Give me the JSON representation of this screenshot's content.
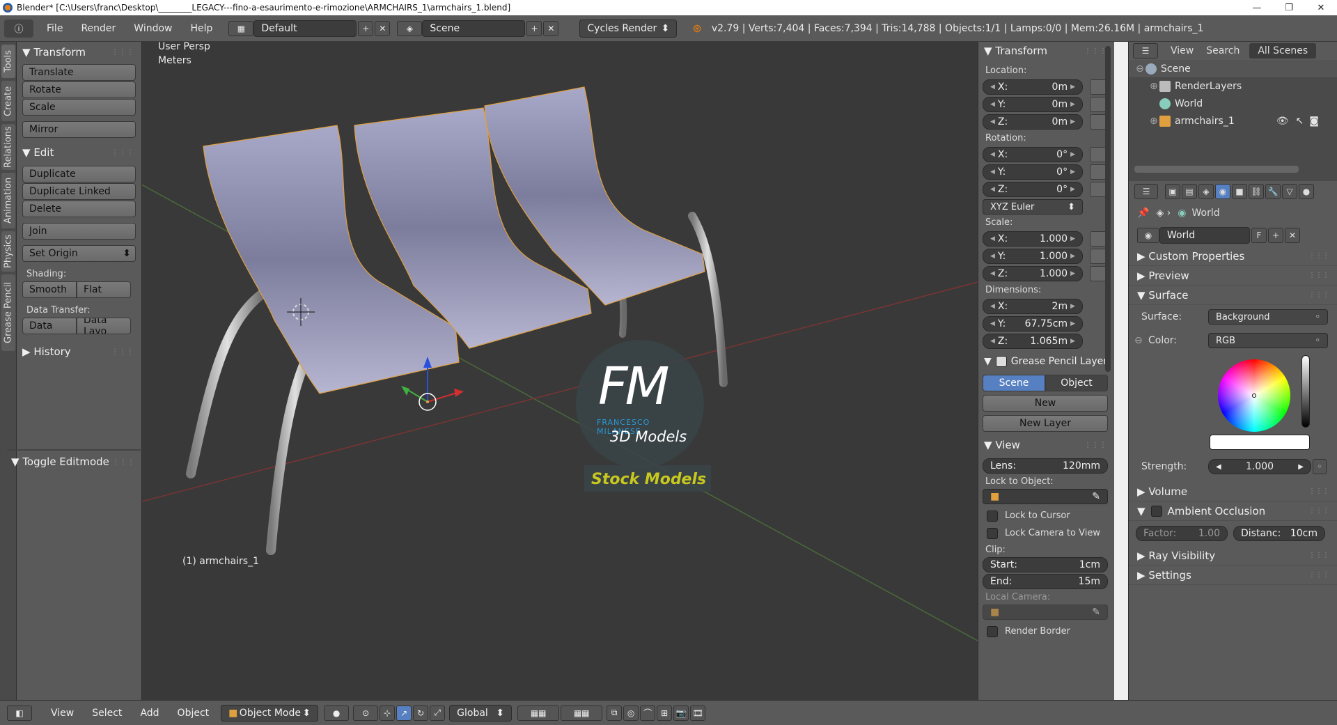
{
  "window": {
    "title": "Blender* [C:\\Users\\franc\\Desktop\\________LEGACY---fino-a-esaurimento-e-rimozione\\ARMCHAIRS_1\\armchairs_1.blend]",
    "minimize": "—",
    "maximize": "❐",
    "close": "✕"
  },
  "menu": {
    "info_icon": "ⓘ",
    "file": "File",
    "render": "Render",
    "window": "Window",
    "help": "Help",
    "layout": "Default",
    "scene": "Scene",
    "engine": "Cycles Render"
  },
  "stats": "v2.79 | Verts:7,404 | Faces:7,394 | Tris:14,788 | Objects:1/1 | Lamps:0/0 | Mem:26.16M | armchairs_1",
  "lefttabs": [
    "Tools",
    "Create",
    "Relations",
    "Animation",
    "Physics",
    "Grease Pencil"
  ],
  "tools": {
    "transform_header": "Transform",
    "translate": "Translate",
    "rotate": "Rotate",
    "scale": "Scale",
    "mirror": "Mirror",
    "edit_header": "Edit",
    "duplicate": "Duplicate",
    "duplicate_linked": "Duplicate Linked",
    "delete": "Delete",
    "join": "Join",
    "set_origin": "Set Origin",
    "shading_label": "Shading:",
    "smooth": "Smooth",
    "flat": "Flat",
    "data_transfer_label": "Data Transfer:",
    "data": "Data",
    "data_layout": "Data Layo",
    "history": "History",
    "toggle_editmode": "Toggle Editmode"
  },
  "viewport": {
    "view_name": "User Persp",
    "units": "Meters",
    "object_label": "(1) armchairs_1",
    "watermark_initials": "FM",
    "watermark_name": "FRANCESCO MILANESE",
    "watermark_sub": "3D Models",
    "watermark_tag": "Stock Models"
  },
  "npanel": {
    "transform_header": "Transform",
    "location_label": "Location:",
    "loc": [
      {
        "axis": "X:",
        "value": "0m"
      },
      {
        "axis": "Y:",
        "value": "0m"
      },
      {
        "axis": "Z:",
        "value": "0m"
      }
    ],
    "rotation_label": "Rotation:",
    "rot": [
      {
        "axis": "X:",
        "value": "0°"
      },
      {
        "axis": "Y:",
        "value": "0°"
      },
      {
        "axis": "Z:",
        "value": "0°"
      }
    ],
    "rotation_mode": "XYZ Euler",
    "scale_label": "Scale:",
    "scale": [
      {
        "axis": "X:",
        "value": "1.000"
      },
      {
        "axis": "Y:",
        "value": "1.000"
      },
      {
        "axis": "Z:",
        "value": "1.000"
      }
    ],
    "dimensions_label": "Dimensions:",
    "dims": [
      {
        "axis": "X:",
        "value": "2m"
      },
      {
        "axis": "Y:",
        "value": "67.75cm"
      },
      {
        "axis": "Z:",
        "value": "1.065m"
      }
    ],
    "grease_header": "Grease Pencil Layer",
    "gp_scene": "Scene",
    "gp_object": "Object",
    "gp_new": "New",
    "gp_new_layer": "New Layer",
    "view_header": "View",
    "lens_label": "Lens:",
    "lens_value": "120mm",
    "lock_obj_label": "Lock to Object:",
    "lock_cursor": "Lock to Cursor",
    "lock_camera": "Lock Camera to View",
    "clip_label": "Clip:",
    "clip_start_label": "Start:",
    "clip_start": "1cm",
    "clip_end_label": "End:",
    "clip_end": "15m",
    "local_camera": "Local Camera:",
    "render_border": "Render Border"
  },
  "outliner": {
    "view": "View",
    "search": "Search",
    "filter": "All Scenes",
    "items": [
      "Scene",
      "RenderLayers",
      "World",
      "armchairs_1"
    ]
  },
  "properties": {
    "context": "World",
    "world_name": "World",
    "world_f": "F",
    "custom_props": "Custom Properties",
    "preview": "Preview",
    "surface_header": "Surface",
    "surface_label": "Surface:",
    "surface_value": "Background",
    "color_label": "Color:",
    "color_value": "RGB",
    "strength_label": "Strength:",
    "strength_value": "1.000",
    "volume": "Volume",
    "ambient_occlusion": "Ambient Occlusion",
    "factor_label": "Factor:",
    "factor_value": "1.00",
    "distance_label": "Distanc:",
    "distance_value": "10cm",
    "ray_visibility": "Ray Visibility",
    "settings": "Settings"
  },
  "bottom": {
    "view": "View",
    "select": "Select",
    "add": "Add",
    "object": "Object",
    "mode": "Object Mode",
    "orientation": "Global"
  }
}
